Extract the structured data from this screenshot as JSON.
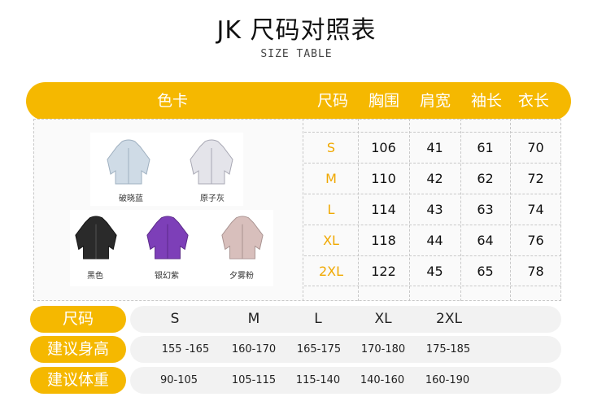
{
  "title": "JK 尺码对照表",
  "subtitle": "SIZE TABLE",
  "header": {
    "color_card": "色卡",
    "size": "尺码",
    "chest": "胸围",
    "shoulder": "肩宽",
    "sleeve": "袖长",
    "length": "衣长"
  },
  "colors": [
    {
      "name": "破晓蓝",
      "hex": "#cfdbe6"
    },
    {
      "name": "原子灰",
      "hex": "#e4e4ea"
    },
    {
      "name": "黑色",
      "hex": "#2a2a2a"
    },
    {
      "name": "银幻紫",
      "hex": "#7d3fb8"
    },
    {
      "name": "夕雾粉",
      "hex": "#d8bfbc"
    }
  ],
  "size_rows": [
    {
      "size": "S",
      "chest": "106",
      "shoulder": "41",
      "sleeve": "61",
      "length": "70"
    },
    {
      "size": "M",
      "chest": "110",
      "shoulder": "42",
      "sleeve": "62",
      "length": "72"
    },
    {
      "size": "L",
      "chest": "114",
      "shoulder": "43",
      "sleeve": "63",
      "length": "74"
    },
    {
      "size": "XL",
      "chest": "118",
      "shoulder": "44",
      "sleeve": "64",
      "length": "76"
    },
    {
      "size": "2XL",
      "chest": "122",
      "shoulder": "45",
      "sleeve": "65",
      "length": "78"
    }
  ],
  "recommend": {
    "size_label": "尺码",
    "height_label": "建议身高",
    "weight_label": "建议体重",
    "sizes": [
      "S",
      "M",
      "L",
      "XL",
      "2XL"
    ],
    "heights": [
      "155 -165",
      "160-170",
      "165-175",
      "170-180",
      "175-185"
    ],
    "weights": [
      "90-105",
      "105-115",
      "115-140",
      "140-160",
      "160-190"
    ]
  },
  "accent_color": "#f5b800",
  "size_text_color": "#f0a800"
}
